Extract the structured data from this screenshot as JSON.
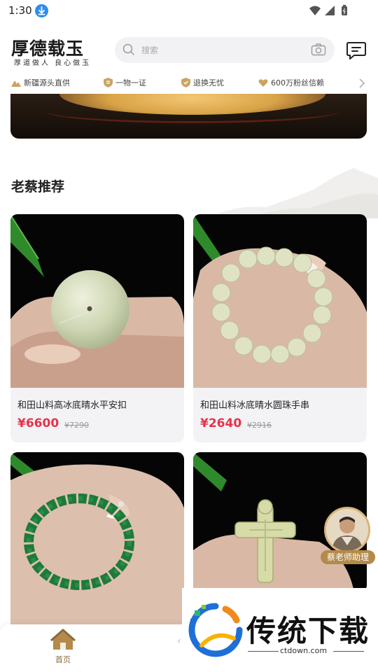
{
  "status_bar": {
    "time": "1:30"
  },
  "header": {
    "logo_text": "厚德载玉",
    "logo_sub": "厚道做人 良心做玉",
    "search_placeholder": "搜索"
  },
  "features": [
    {
      "label": "新疆源头直供",
      "icon": "mountain-icon"
    },
    {
      "label": "一物一证",
      "icon": "certificate-icon"
    },
    {
      "label": "退换无忧",
      "icon": "shield-icon"
    },
    {
      "label": "600万粉丝信赖",
      "icon": "heart-hand-icon"
    }
  ],
  "section_title": "老蔡推荐",
  "products": [
    {
      "name": "和田山料高冰底晴水平安扣",
      "price": "¥6600",
      "orig_price": "¥7290"
    },
    {
      "name": "和田山料冰底晴水圆珠手串",
      "price": "¥2640",
      "orig_price": "¥2916"
    },
    {
      "name": "",
      "price": "",
      "orig_price": ""
    },
    {
      "name": "",
      "price": "",
      "orig_price": ""
    }
  ],
  "assistant": {
    "label": "蔡老师助理"
  },
  "bottom_nav": {
    "home_label": "首页"
  },
  "watermark": {
    "title": "传统下载",
    "url": "ctdown.com"
  },
  "colors": {
    "price_red": "#e8304b",
    "gold": "#b38a4a",
    "page_bg": "#ffffff",
    "card_bg": "#f3f3f5"
  }
}
